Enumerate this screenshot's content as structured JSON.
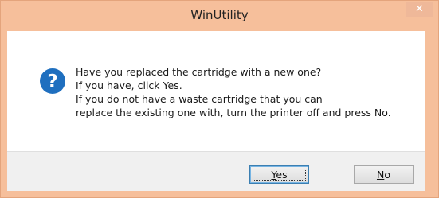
{
  "window": {
    "title": "WinUtility",
    "close_glyph": "✕"
  },
  "dialog": {
    "icon": "question-icon",
    "message_lines": [
      "Have you replaced the cartridge with a new one?",
      "If you have, click Yes.",
      "If you do not have a waste cartridge that you can",
      "replace the existing one with, turn the printer off and press No."
    ]
  },
  "buttons": {
    "yes": {
      "accel": "Y",
      "rest": "es"
    },
    "no": {
      "accel": "N",
      "rest": "o"
    }
  },
  "colors": {
    "titlebar": "#f6bf9b",
    "icon": "#1f6fbf",
    "default_button_border": "#3c7fb1"
  }
}
